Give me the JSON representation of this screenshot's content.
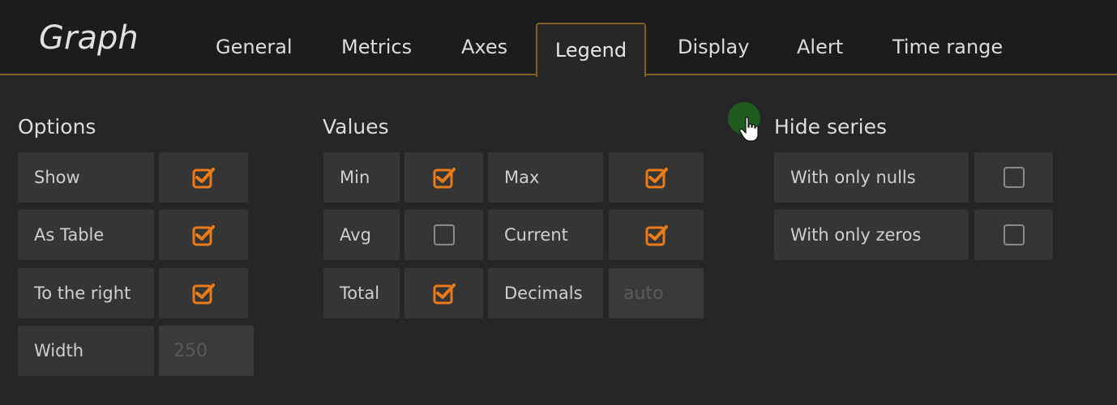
{
  "header": {
    "title": "Graph",
    "tabs": [
      "General",
      "Metrics",
      "Axes",
      "Legend",
      "Display",
      "Alert",
      "Time range"
    ],
    "active_tab": "Legend"
  },
  "options": {
    "title": "Options",
    "show": {
      "label": "Show",
      "checked": true
    },
    "as_table": {
      "label": "As Table",
      "checked": true
    },
    "to_the_right": {
      "label": "To the right",
      "checked": true
    },
    "width": {
      "label": "Width",
      "placeholder": "250"
    }
  },
  "values": {
    "title": "Values",
    "min": {
      "label": "Min",
      "checked": true
    },
    "max": {
      "label": "Max",
      "checked": true
    },
    "avg": {
      "label": "Avg",
      "checked": false
    },
    "current": {
      "label": "Current",
      "checked": true
    },
    "total": {
      "label": "Total",
      "checked": true
    },
    "decimals": {
      "label": "Decimals",
      "placeholder": "auto"
    }
  },
  "hide_series": {
    "title": "Hide series",
    "with_only_nulls": {
      "label": "With only nulls",
      "checked": false
    },
    "with_only_zeros": {
      "label": "With only zeros",
      "checked": false
    }
  },
  "colors": {
    "accent": "#eb7b18",
    "tab_border": "#7d6127",
    "background": "#262626",
    "cell": "#353535"
  },
  "icons": {
    "checked": "checkbox-checked-icon",
    "unchecked": "checkbox-unchecked-icon",
    "cursor": "hand-pointer-icon"
  }
}
